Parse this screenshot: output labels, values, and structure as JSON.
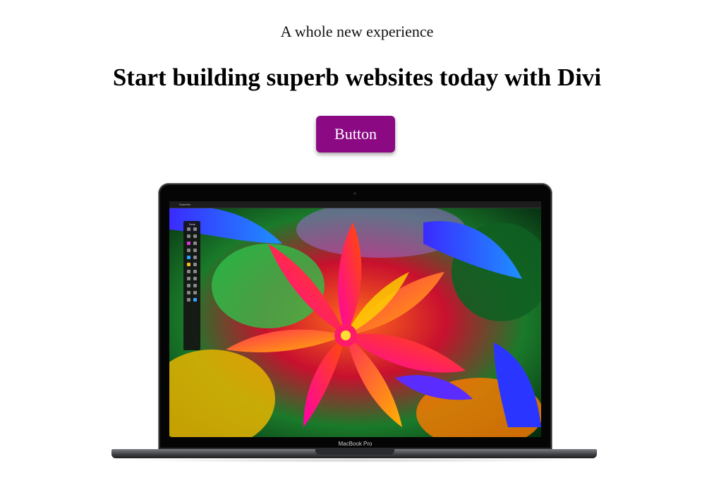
{
  "hero": {
    "subtitle": "A whole new experience",
    "headline": "Start building superb websites today with Divi",
    "button_label": "Button"
  },
  "laptop": {
    "brand_label": "MacBook Pro",
    "menubar_text": "Diameter",
    "tools_title": "Tools"
  },
  "colors": {
    "button_bg": "#8b0a83",
    "button_text": "#ffffff",
    "page_bg": "#ffffff"
  }
}
